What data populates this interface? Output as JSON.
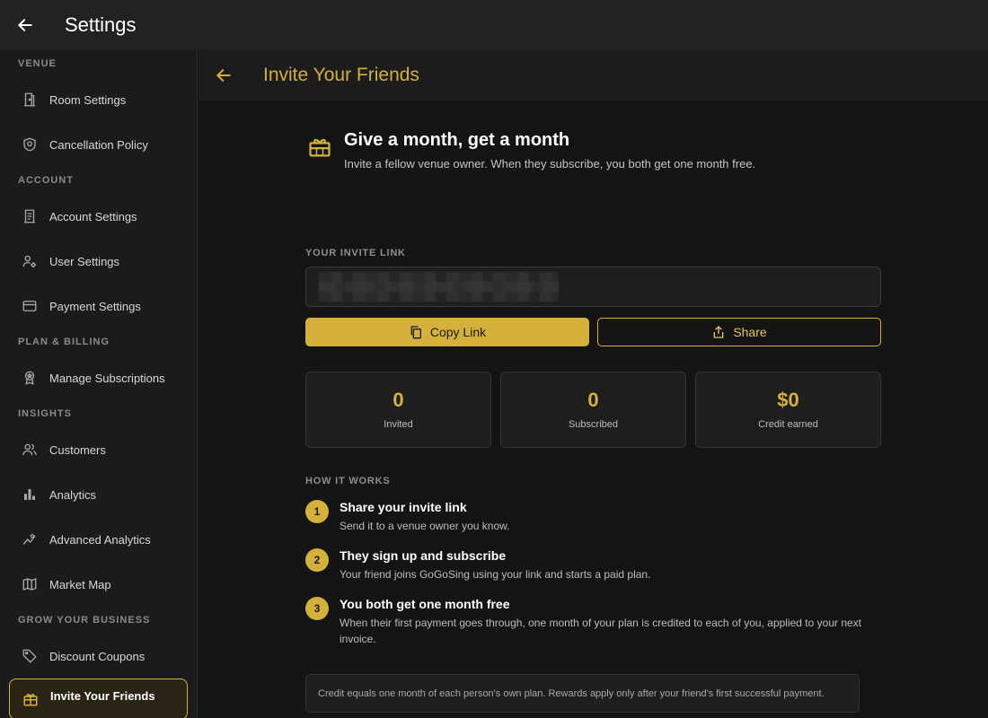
{
  "appbar": {
    "title": "Settings"
  },
  "sidebar": {
    "sections": [
      {
        "title": "VENUE",
        "items": [
          {
            "label": "Room Settings",
            "icon": "door-icon"
          },
          {
            "label": "Cancellation Policy",
            "icon": "shield-icon"
          }
        ]
      },
      {
        "title": "ACCOUNT",
        "items": [
          {
            "label": "Account Settings",
            "icon": "receipt-icon"
          },
          {
            "label": "User Settings",
            "icon": "user-gear-icon"
          },
          {
            "label": "Payment Settings",
            "icon": "credit-card-icon"
          }
        ]
      },
      {
        "title": "PLAN & BILLING",
        "items": [
          {
            "label": "Manage Subscriptions",
            "icon": "badge-icon"
          }
        ]
      },
      {
        "title": "INSIGHTS",
        "items": [
          {
            "label": "Customers",
            "icon": "people-icon"
          },
          {
            "label": "Analytics",
            "icon": "bar-chart-icon"
          },
          {
            "label": "Advanced Analytics",
            "icon": "trend-icon"
          },
          {
            "label": "Market Map",
            "icon": "map-icon"
          }
        ]
      },
      {
        "title": "GROW YOUR BUSINESS",
        "items": [
          {
            "label": "Discount Coupons",
            "icon": "tag-icon"
          },
          {
            "label": "Invite Your Friends",
            "icon": "gift-icon",
            "active": true
          }
        ]
      }
    ]
  },
  "main": {
    "title": "Invite Your Friends",
    "hero": {
      "title": "Give a month, get a month",
      "subtitle": "Invite a fellow venue owner. When they subscribe, you both get one month free."
    },
    "invite_link_label": "YOUR INVITE LINK",
    "buttons": {
      "copy": "Copy Link",
      "share": "Share"
    },
    "stats": [
      {
        "value": "0",
        "caption": "Invited"
      },
      {
        "value": "0",
        "caption": "Subscribed"
      },
      {
        "value": "$0",
        "caption": "Credit earned"
      }
    ],
    "how_it_works_label": "HOW IT WORKS",
    "steps": [
      {
        "num": "1",
        "title": "Share your invite link",
        "desc": "Send it to a venue owner you know."
      },
      {
        "num": "2",
        "title": "They sign up and subscribe",
        "desc": "Your friend joins GoGoSing using your link and starts a paid plan."
      },
      {
        "num": "3",
        "title": "You both get one month free",
        "desc": "When their first payment goes through, one month of your plan is credited to each of you, applied to your next invoice."
      }
    ],
    "note": "Credit equals one month of each person's own plan. Rewards apply only after your friend's first successful payment."
  },
  "colors": {
    "accent": "#d4b13a",
    "background": "#141414",
    "sidebar": "#1b1b1b"
  }
}
